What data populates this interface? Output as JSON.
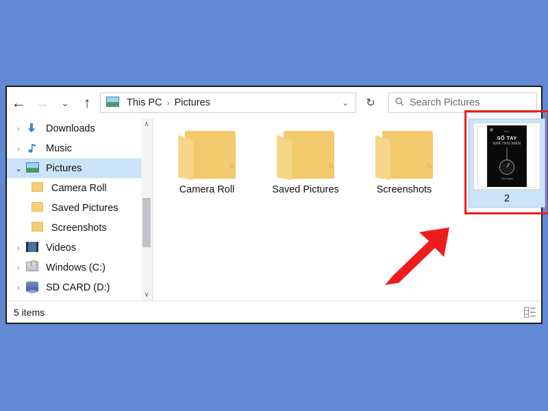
{
  "desktop": {
    "background_color": "#6189d4"
  },
  "window": {
    "border_color": "#1b1b1b",
    "nav": {
      "back": "←",
      "forward": "→",
      "recent_chevron": "⌄",
      "up": "↑"
    },
    "address": {
      "icon": "pictures-library-icon",
      "crumbs": [
        "This PC",
        "Pictures"
      ],
      "separator": "›",
      "chevron": "⌄"
    },
    "refresh_glyph": "↻",
    "search": {
      "icon": "search-icon",
      "placeholder": "Search Pictures",
      "value": ""
    }
  },
  "sidebar": {
    "items": [
      {
        "label": "Downloads",
        "icon": "download-icon",
        "twisty": "›",
        "expanded": false,
        "selected": false,
        "indent": false
      },
      {
        "label": "Music",
        "icon": "music-note-icon",
        "twisty": "›",
        "expanded": false,
        "selected": false,
        "indent": false
      },
      {
        "label": "Pictures",
        "icon": "pictures-icon",
        "twisty": "⌄",
        "expanded": true,
        "selected": true,
        "indent": false
      },
      {
        "label": "Camera Roll",
        "icon": "folder-icon",
        "twisty": "",
        "expanded": false,
        "selected": false,
        "indent": true
      },
      {
        "label": "Saved Pictures",
        "icon": "folder-icon",
        "twisty": "",
        "expanded": false,
        "selected": false,
        "indent": true
      },
      {
        "label": "Screenshots",
        "icon": "folder-icon",
        "twisty": "",
        "expanded": false,
        "selected": false,
        "indent": true
      },
      {
        "label": "Videos",
        "icon": "video-icon",
        "twisty": "›",
        "expanded": false,
        "selected": false,
        "indent": false
      },
      {
        "label": "Windows (C:)",
        "icon": "drive-lock-icon",
        "twisty": "›",
        "expanded": false,
        "selected": false,
        "indent": false
      },
      {
        "label": "SD CARD (D:)",
        "icon": "sd-card-icon",
        "twisty": "›",
        "expanded": false,
        "selected": false,
        "indent": false
      }
    ],
    "scrollbar": {
      "up_arrow": "∧",
      "down_arrow": "∨"
    }
  },
  "content": {
    "folders": [
      {
        "label": "Camera Roll"
      },
      {
        "label": "Saved Pictures"
      },
      {
        "label": "Screenshots"
      }
    ],
    "selected_image": {
      "label": "2",
      "selected": true,
      "cover": {
        "top_tag": "ĐỘC",
        "title": "SỔ TAY",
        "subtitle": "NHÀ THÔI MIÊN",
        "author": "Trần Huyền"
      }
    }
  },
  "annotations": {
    "highlight_box_color": "#ee1c1c",
    "arrow_color": "#ee1c1c"
  },
  "status": {
    "item_count": "5 items",
    "view_icons": [
      "details-view-icon",
      "list-view-icon"
    ]
  }
}
